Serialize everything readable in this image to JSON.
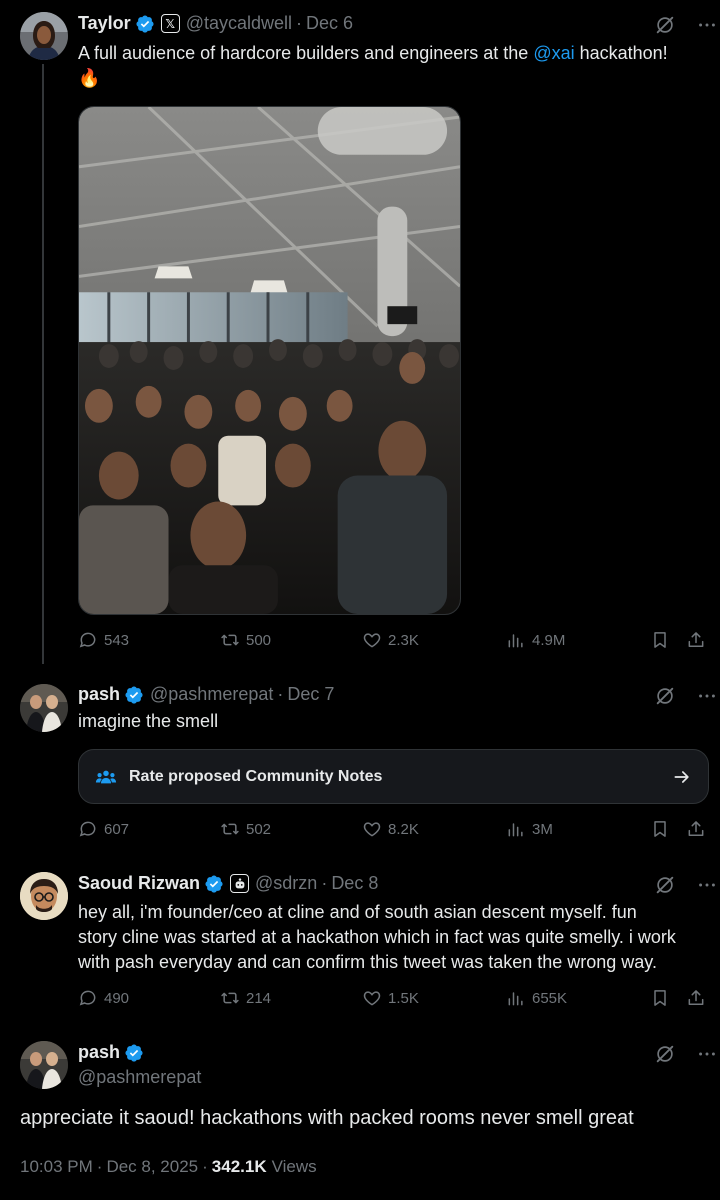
{
  "post1": {
    "name": "Taylor",
    "handle": "@taycaldwell",
    "date": "Dec 6",
    "text_before": "A full audience of hardcore builders and engineers at the ",
    "mention": "@xai",
    "text_after": " hackathon!",
    "emoji": "🔥",
    "replies": "543",
    "reposts": "500",
    "likes": "2.3K",
    "views": "4.9M"
  },
  "post2": {
    "name": "pash",
    "handle": "@pashmerepat",
    "date": "Dec 7",
    "text": "imagine the smell",
    "community_notes_label": "Rate proposed Community Notes",
    "replies": "607",
    "reposts": "502",
    "likes": "8.2K",
    "views": "3M"
  },
  "post3": {
    "name": "Saoud Rizwan",
    "handle": "@sdrzn",
    "date": "Dec 8",
    "text_lines": [
      "hey all, i'm founder/ceo at cline and of south asian descent myself. fun",
      "story cline was started at a hackathon which in fact was quite smelly. i work",
      "with pash everyday and can confirm this tweet was taken the wrong way."
    ],
    "replies": "490",
    "reposts": "214",
    "likes": "1.5K",
    "views": "655K"
  },
  "post4": {
    "name": "pash",
    "handle": "@pashmerepat",
    "text": "appreciate it saoud! hackathons with packed rooms never smell great",
    "time": "10:03 PM",
    "date": "Dec 8, 2025",
    "views_count": "342.1K",
    "views_label": "Views"
  },
  "colors": {
    "background": "#000000",
    "text": "#e7e9ea",
    "muted": "#71767b",
    "accent": "#1d9bf0",
    "border": "#2f3336"
  }
}
